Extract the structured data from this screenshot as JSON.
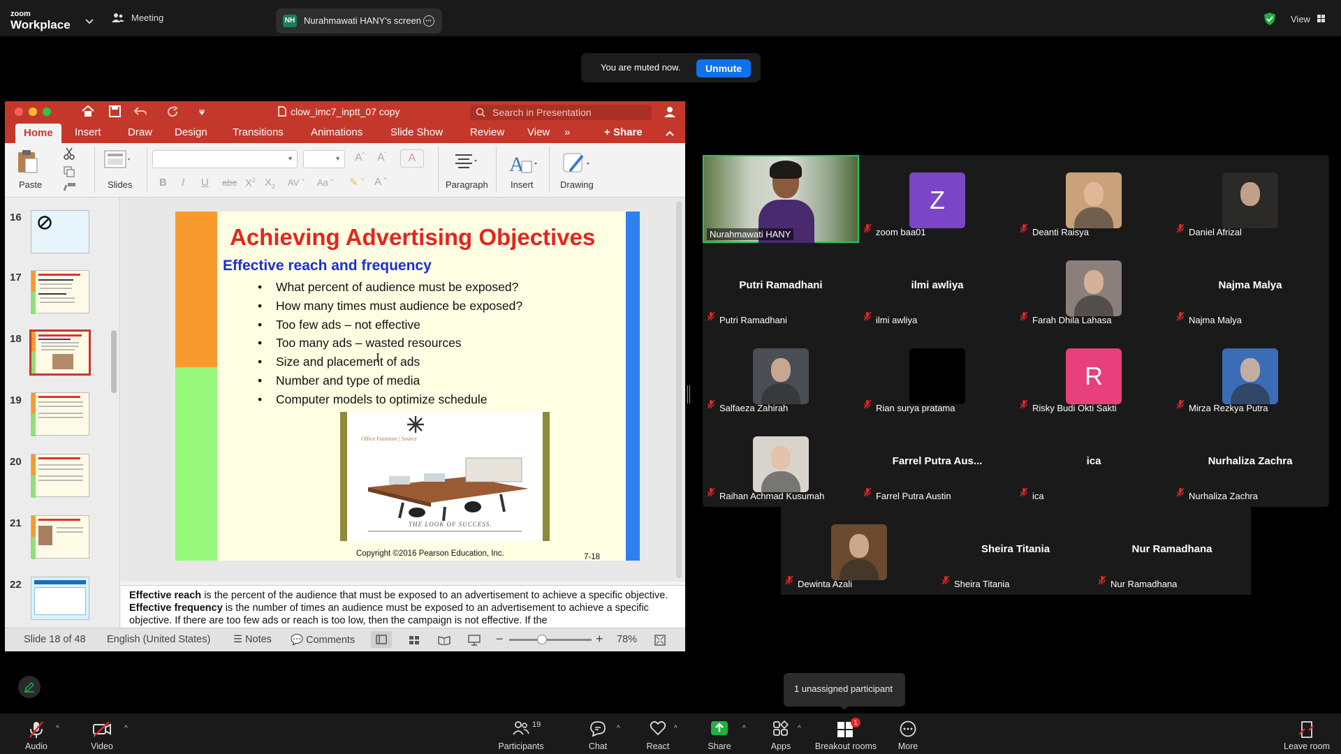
{
  "app": {
    "logo_small": "zoom",
    "logo_big": "Workplace",
    "meeting_label": "Meeting",
    "share_pill": {
      "initials": "NH",
      "text": "Nurahmawati HANY's screen"
    },
    "view_label": "View"
  },
  "mute_banner": {
    "text": "You are muted now.",
    "button": "Unmute"
  },
  "ppt": {
    "doc_title": "clow_imc7_inptt_07 copy",
    "search_placeholder": "Search in Presentation",
    "tabs": [
      "Home",
      "Insert",
      "Draw",
      "Design",
      "Transitions",
      "Animations",
      "Slide Show",
      "Review",
      "View"
    ],
    "share_label": "Share",
    "ribbon_labels": {
      "paste": "Paste",
      "slides": "Slides",
      "paragraph": "Paragraph",
      "insert": "Insert",
      "drawing": "Drawing"
    },
    "thumb_numbers": [
      "16",
      "17",
      "18",
      "19",
      "20",
      "21",
      "22"
    ],
    "slide": {
      "title": "Achieving Advertising Objectives",
      "subtitle": "Effective reach and frequency",
      "bullets": [
        "What percent of audience must be exposed?",
        "How many times must audience be exposed?",
        "Too few ads – not effective",
        "Too many ads – wasted resources",
        "Size and placement of ads",
        "Number and type of media",
        "Computer models to optimize schedule"
      ],
      "ad_brand": "Office Furniture | Source",
      "ad_tagline": "THE LOOK OF SUCCESS.",
      "copyright": "Copyright ©2016 Pearson Education, Inc.",
      "page_num": "7-18"
    },
    "notes": {
      "b1": "Effective reach",
      "t1": " is the percent of the audience that  must be exposed to an advertisement to achieve a specific objective. ",
      "b2": "Effective frequency",
      "t2": " is the number of times an audience must be exposed to an advertisement to achieve a specific objective. If there are too few ads or reach is too low, then the campaign is not effective. If the"
    },
    "status": {
      "slide": "Slide 18 of 48",
      "language": "English (United States)",
      "notes": "Notes",
      "comments": "Comments",
      "zoom": "78%"
    }
  },
  "participants": [
    {
      "name": "Nurahmawati HANY",
      "kind": "video",
      "speaking": true
    },
    {
      "name": "zoom baa01",
      "kind": "letter",
      "letter": "Z",
      "color": "#7b45c8"
    },
    {
      "name": "Deanti Raisya",
      "kind": "photo",
      "color": "#c9a27a"
    },
    {
      "name": "Daniel Afrizal",
      "kind": "photo",
      "color": "#2c2a28"
    },
    {
      "name": "Putri Ramadhani",
      "kind": "text"
    },
    {
      "name": "ilmi awliya",
      "kind": "text"
    },
    {
      "name": "Farah Dhila Lahasa",
      "kind": "photo",
      "color": "#8a7f7a"
    },
    {
      "name": "Najma Malya",
      "kind": "text"
    },
    {
      "name": "Salfaeza Zahirah",
      "kind": "photo",
      "color": "#4a4e55"
    },
    {
      "name": "Rian surya pratama",
      "kind": "black"
    },
    {
      "name": "Risky Budi Okti Sakti",
      "kind": "letter",
      "letter": "R",
      "color": "#e8407a"
    },
    {
      "name": "Mirza Rezkya Putra",
      "kind": "photo",
      "color": "#3a6db5"
    },
    {
      "name": "Raihan Achmad Kusumah",
      "kind": "photo",
      "color": "#d8d4cc"
    },
    {
      "name": "Farrel Putra Austin",
      "kind": "text",
      "display": "Farrel Putra Aus..."
    },
    {
      "name": "ica",
      "kind": "text"
    },
    {
      "name": "Nurhaliza Zachra",
      "kind": "text"
    },
    {
      "name": "Dewinta Azali",
      "kind": "photo",
      "color": "#6b4a30"
    },
    {
      "name": "Sheira Titania",
      "kind": "text"
    },
    {
      "name": "Nur Ramadhana",
      "kind": "text"
    }
  ],
  "unassigned_tooltip": "1 unassigned participant",
  "toolbar": {
    "audio": "Audio",
    "video": "Video",
    "participants": "Participants",
    "participant_count": "19",
    "chat": "Chat",
    "react": "React",
    "share": "Share",
    "apps": "Apps",
    "breakout": "Breakout rooms",
    "breakout_badge": "1",
    "more": "More",
    "leave": "Leave room"
  }
}
